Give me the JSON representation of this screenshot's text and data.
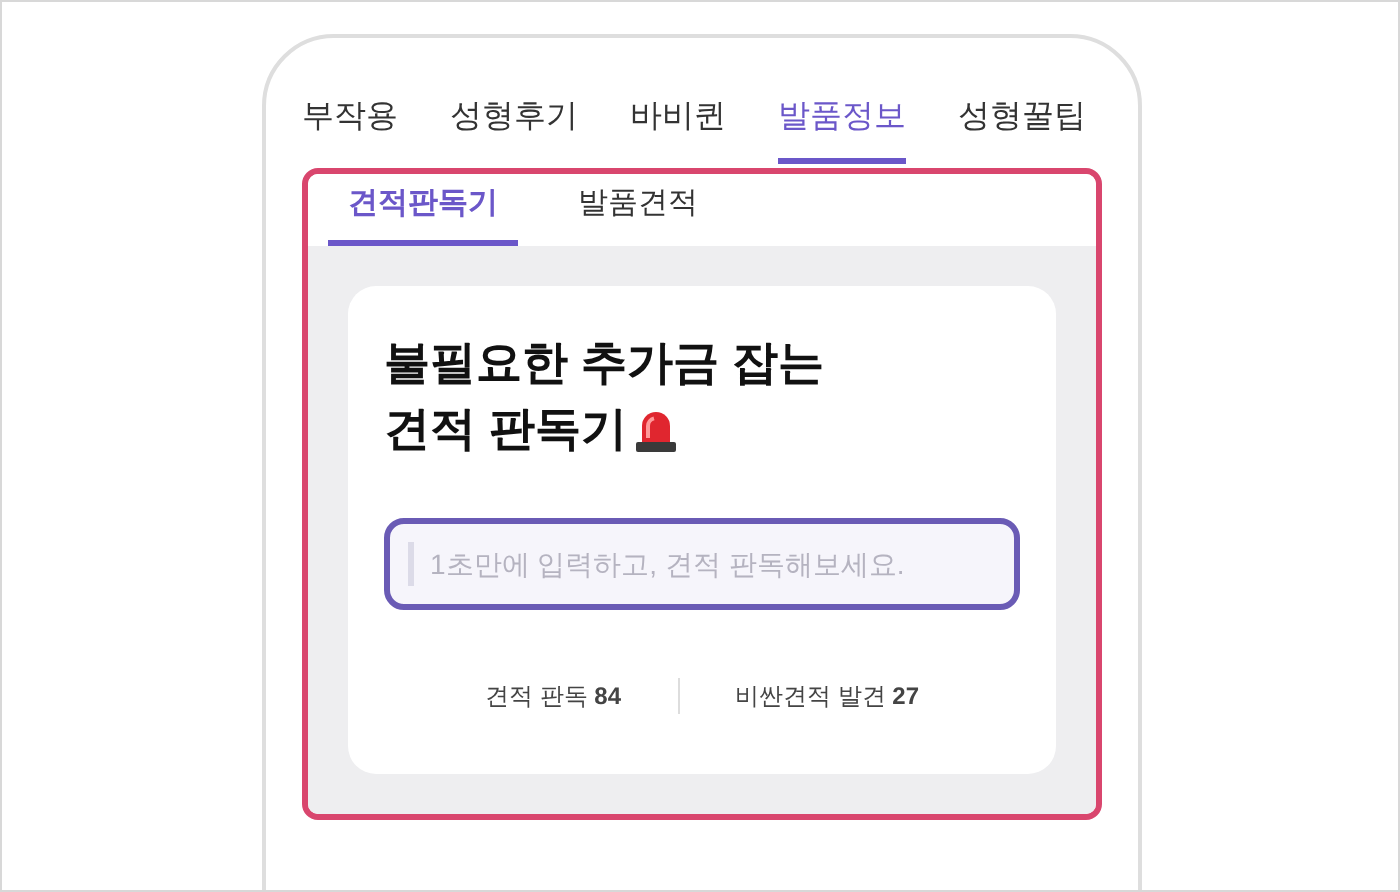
{
  "top_tabs": [
    {
      "label": "부작용",
      "selected": false
    },
    {
      "label": "성형후기",
      "selected": false
    },
    {
      "label": "바비퀸",
      "selected": false
    },
    {
      "label": "발품정보",
      "selected": true
    },
    {
      "label": "성형꿀팁",
      "selected": false
    }
  ],
  "sub_tabs": [
    {
      "label": "견적판독기",
      "selected": true
    },
    {
      "label": "발품견적",
      "selected": false
    }
  ],
  "card": {
    "headline": [
      "불필요한 추가금 잡는",
      "견적 판독기"
    ],
    "input": {
      "placeholder": "1초만에 입력하고, 견적 판독해보세요."
    },
    "stats": [
      "견적 판독 **84**",
      "비싼견적 발견 **27**"
    ]
  }
}
